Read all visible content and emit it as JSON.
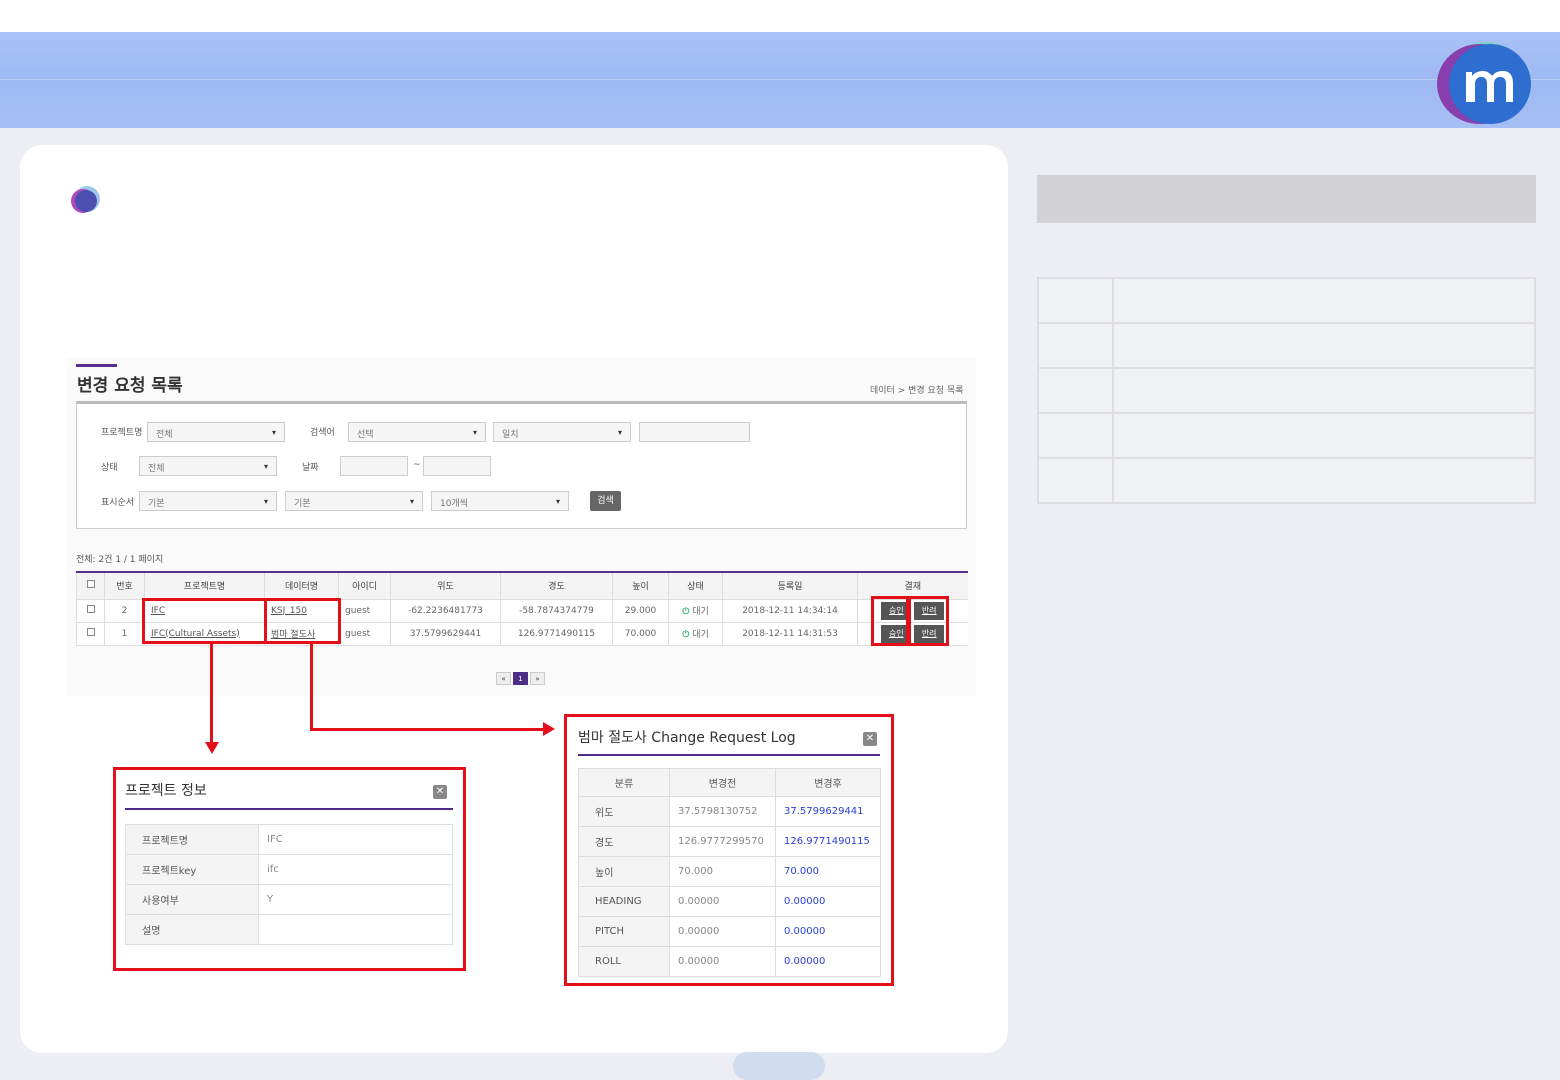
{
  "screen": {
    "title": "변경 요청 목록",
    "breadcrumb": "데이터 > 변경 요청 목록"
  },
  "filters": {
    "project_label": "프로젝트명",
    "project_value": "전체",
    "keyword_label": "검색어",
    "keyword_value": "선택",
    "match_value": "일치",
    "status_label": "상태",
    "status_value": "전체",
    "date_label": "날짜",
    "date_sep": "~",
    "order_label": "표시순서",
    "order_value_1": "기본",
    "order_value_2": "기본",
    "count_value": "10개씩",
    "search_button": "검색"
  },
  "list": {
    "total": "전체: 2건 1 / 1 페이지",
    "columns": [
      "",
      "번호",
      "프로젝트명",
      "데이터명",
      "아이디",
      "위도",
      "경도",
      "높이",
      "상태",
      "등록일",
      "결재"
    ],
    "rows": [
      {
        "no": "2",
        "project": "IFC",
        "data": "KSJ_150",
        "id": "guest",
        "lat": "-62.2236481773",
        "lon": "-58.7874374779",
        "alt": "29.000",
        "status": "대기",
        "date": "2018-12-11 14:34:14",
        "approve": "승인",
        "reject": "반려"
      },
      {
        "no": "1",
        "project": "IFC(Cultural Assets)",
        "data": "범마 절도사",
        "id": "guest",
        "lat": "37.5799629441",
        "lon": "126.9771490115",
        "alt": "70.000",
        "status": "대기",
        "date": "2018-12-11 14:31:53",
        "approve": "승인",
        "reject": "반려"
      }
    ],
    "pager": {
      "first": "«",
      "current": "1",
      "last": "»"
    }
  },
  "project_popup": {
    "title": "프로젝트 정보",
    "rows": [
      {
        "key": "프로젝트명",
        "value": "IFC"
      },
      {
        "key": "프로젝트key",
        "value": "ifc"
      },
      {
        "key": "사용여부",
        "value": "Y"
      },
      {
        "key": "설명",
        "value": ""
      }
    ]
  },
  "log_popup": {
    "title": "범마 절도사 Change Request Log",
    "headers": [
      "분류",
      "변경전",
      "변경후"
    ],
    "rows": [
      {
        "key": "위도",
        "before": "37.5798130752",
        "after": "37.5799629441"
      },
      {
        "key": "경도",
        "before": "126.9777299570",
        "after": "126.9771490115"
      },
      {
        "key": "높이",
        "before": "70.000",
        "after": "70.000"
      },
      {
        "key": "HEADING",
        "before": "0.00000",
        "after": "0.00000"
      },
      {
        "key": "PITCH",
        "before": "0.00000",
        "after": "0.00000"
      },
      {
        "key": "ROLL",
        "before": "0.00000",
        "after": "0.00000"
      }
    ]
  },
  "colors": {
    "header_band": "#a9c2f7",
    "accent_purple": "#4b2c86",
    "highlight_red": "#e3101a",
    "status_green": "#3cb371",
    "after_value_blue": "#2b3fd6"
  },
  "icons": [
    "logo-m-icon",
    "bullet-circle-icon",
    "power-icon",
    "close-icon",
    "caret-down-icon"
  ]
}
